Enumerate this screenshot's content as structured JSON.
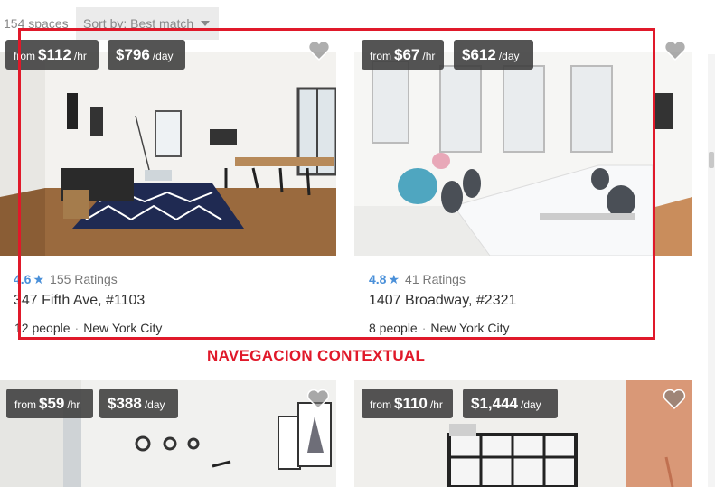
{
  "toolbar": {
    "results_count": "154 spaces",
    "sort_label": "Sort by:",
    "sort_value": "Best match"
  },
  "listings": [
    {
      "price_hour_prefix": "from",
      "price_hour": "$112",
      "price_hour_unit": "/hr",
      "price_day": "$796",
      "price_day_unit": "/day",
      "rating": "4.6",
      "ratings_count": "155 Ratings",
      "address": "347 Fifth Ave, #1103",
      "capacity": "12 people",
      "city": "New York City"
    },
    {
      "price_hour_prefix": "from",
      "price_hour": "$67",
      "price_hour_unit": "/hr",
      "price_day": "$612",
      "price_day_unit": "/day",
      "rating": "4.8",
      "ratings_count": "41 Ratings",
      "address": "1407 Broadway, #2321",
      "capacity": "8 people",
      "city": "New York City"
    },
    {
      "price_hour_prefix": "from",
      "price_hour": "$59",
      "price_hour_unit": "/hr",
      "price_day": "$388",
      "price_day_unit": "/day"
    },
    {
      "price_hour_prefix": "from",
      "price_hour": "$110",
      "price_hour_unit": "/hr",
      "price_day": "$1,444",
      "price_day_unit": "/day"
    }
  ],
  "annotation": "NAVEGACION CONTEXTUAL",
  "colors": {
    "accent_blue": "#4a90d9",
    "annotation_red": "#e0192a",
    "badge_bg": "#3c3c3c"
  },
  "icons": [
    "heart-icon",
    "star-icon",
    "caret-down-icon"
  ]
}
